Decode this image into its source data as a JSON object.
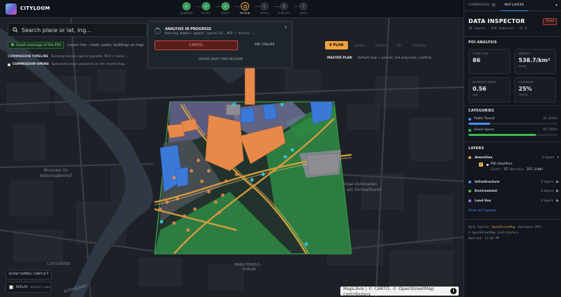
{
  "app": {
    "name": "CITYLOOM"
  },
  "steps": [
    {
      "label": "SUMMARY",
      "state": "done",
      "mark": "✓"
    },
    {
      "label": "METRIC",
      "state": "done",
      "mark": "✓"
    },
    {
      "label": "DRAFT",
      "state": "done",
      "mark": "✓"
    },
    {
      "label": "REVIEW",
      "state": "active",
      "mark": ""
    },
    {
      "label": "SPECS",
      "state": "pending",
      "mark": "5"
    },
    {
      "label": "PUBLISH",
      "state": "pending",
      "mark": "6"
    },
    {
      "label": "DONE",
      "state": "pending",
      "mark": "7"
    }
  ],
  "search": {
    "placeholder": "Search place or lat, lng..."
  },
  "status": {
    "badge": "Good coverage of the POI",
    "text": "Layers live : roads, parks, buildings on map"
  },
  "timeline": {
    "title": "COMMISSION TIMELINE",
    "running": "Running domain agents (parallel, MCP + tools) ...",
    "opens_label": "COMMISSION OPENS",
    "opens_text": "Specialists begin proposals on the shared map."
  },
  "analysis": {
    "title": "ANALYSIS IN PROGRESS",
    "detail": "Running domain agents (parallel, MCP + tools)...",
    "close": "×",
    "cancel_label": "CANCEL",
    "simfail_label": "SIM. FAILURE",
    "revise_label": "REVISE DRAFT MID-SESSION"
  },
  "plan_tabs": {
    "active": "▼ PLAN",
    "others": [
      "ROADS",
      "AGENTS",
      "REF",
      "COMPARE"
    ]
  },
  "master_plan": {
    "label": "MASTER PLAN",
    "text": "Default map + parcels, live proposals, conflicts"
  },
  "map_labels": {
    "brunnen": [
      "Brunnen im",
      "Kolonnadenhof"
    ],
    "ferrum": [
      "Insel-Kolonaden",
      "am Fernsehturm"
    ],
    "marx": [
      "MARX-ENGELS-",
      "FORUM"
    ],
    "lustgarten": "LUSTGARTEN",
    "schlossplatz": "Schloßplatz"
  },
  "buttons": {
    "sample_conflict": "SHOW SAMPLE CONFLICT",
    "replay": "REPLAY",
    "replay_sub": "export / load"
  },
  "attribution": {
    "text": "MapLibre | © CARTO, © OpenStreetMap contributors",
    "info": "i"
  },
  "panel": {
    "tabs": [
      {
        "label": "COMMISSION",
        "count": "0"
      },
      {
        "label": "MAP LAYERS"
      }
    ],
    "title": "DATA INSPECTOR",
    "subtitle": "18 layers · 354 features · 15.5...",
    "close_label": "Close",
    "poi_section": "POI ANALYSIS",
    "cards": [
      {
        "label": "TOTAL POIS",
        "value": "86",
        "sub": ""
      },
      {
        "label": "DENSITY",
        "value": "538.7/km²",
        "sub": "Dense"
      },
      {
        "label": "DIVERSITY INDEX",
        "value": "0.56",
        "sub": "Low"
      },
      {
        "label": "COVERAGE",
        "value": "25%",
        "sub": "Limited"
      }
    ],
    "categories_section": "CATEGORIES",
    "categories": [
      {
        "name": "Public Transit",
        "count": "21 (24%)",
        "color": "#4f8cff",
        "fill": 0.24
      },
      {
        "name": "Green Space",
        "count": "65 (76%)",
        "color": "#3fb950",
        "fill": 0.76
      }
    ],
    "layers_section": "LAYERS",
    "layers": [
      {
        "name": "Amenities",
        "count": "1 layers",
        "color": "#e1a33c",
        "arrow": "▾"
      },
      {
        "name": "Infrastructure",
        "count": "2 layers",
        "color": "#4f8cff",
        "arrow": "▶"
      },
      {
        "name": "Environment",
        "count": "1 layers",
        "color": "#3fb950",
        "arrow": "▶"
      },
      {
        "name": "Land Use",
        "count": "4 layers",
        "color": "#a371f7",
        "arrow": "▶"
      }
    ],
    "sublayer": {
      "name": "POI classifiers",
      "count_label": "Count:",
      "count": "57",
      "density_label": "Density:",
      "density": "357.1/km²"
    },
    "show_all": "Show all 5 groups",
    "footer": {
      "source_label": "Data Source:",
      "source": "OpenStreetMap",
      "source_tail": "(Overpass API)",
      "copyright": "© OpenStreetMap contributors",
      "queried": "Queried: 11:08 PM"
    }
  },
  "colors": {
    "accent": "#f0a03c",
    "transit": "#4f8cff",
    "green": "#3fb950",
    "building": "#e8894a",
    "landuse": "#a371f7"
  }
}
